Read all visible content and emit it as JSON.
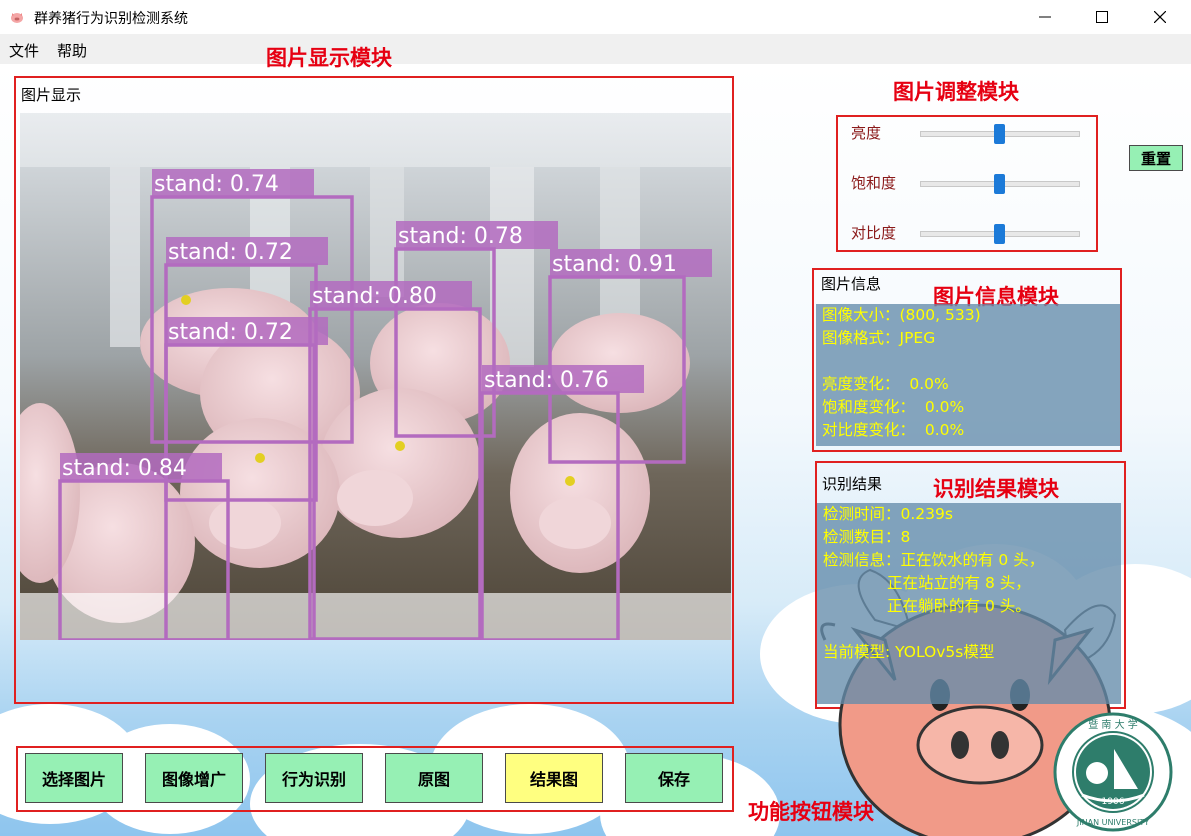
{
  "window": {
    "title": "群养猪行为识别检测系统",
    "minimize_icon": "minimize-icon",
    "maximize_icon": "maximize-icon",
    "close_icon": "close-icon"
  },
  "menu": {
    "items": [
      "文件",
      "帮助"
    ]
  },
  "annotations": {
    "display": "图片显示模块",
    "adjust": "图片调整模块",
    "info": "图片信息模块",
    "result": "识别结果模块",
    "buttons": "功能按钮模块"
  },
  "display": {
    "title": "图片显示",
    "detections": [
      {
        "label": "stand: 0.74"
      },
      {
        "label": "stand: 0.72"
      },
      {
        "label": "stand: 0.78"
      },
      {
        "label": "stand: 0.91"
      },
      {
        "label": "stand: 0.80"
      },
      {
        "label": "stand: 0.72"
      },
      {
        "label": "stand: 0.76"
      },
      {
        "label": "stand: 0.84"
      }
    ]
  },
  "adjust": {
    "brightness_label": "亮度",
    "saturation_label": "饱和度",
    "contrast_label": "对比度",
    "brightness_value": 0.5,
    "saturation_value": 0.5,
    "contrast_value": 0.5,
    "reset_label": "重置"
  },
  "info": {
    "title": "图片信息",
    "size": "图像大小：(800, 533)",
    "format": "图像格式：JPEG",
    "brightness_change": "亮度变化：  0.0%",
    "saturation_change": "饱和度变化：  0.0%",
    "contrast_change": "对比度变化：  0.0%"
  },
  "result": {
    "title": "识别结果",
    "time": "检测时间：0.239s",
    "count": "检测数目：8",
    "info_line1": "检测信息：正在饮水的有 0 头，",
    "info_line2": "             正在站立的有 8 头，",
    "info_line3": "             正在躺卧的有 0 头。",
    "model": "当前模型: YOLOv5s模型"
  },
  "buttons": [
    "选择图片",
    "图像增广",
    "行为识别",
    "原图",
    "结果图",
    "保存"
  ],
  "colors": {
    "annotation_red": "#e60012",
    "button_green": "#96f0b4",
    "button_yellow": "#ffff80",
    "info_text_yellow": "#ffff00",
    "detection_box": "#b36bbf"
  },
  "logo": {
    "top_text": "暨 南 大 学",
    "year": "1906",
    "bottom_text": "JINAN UNIVERSITY"
  }
}
